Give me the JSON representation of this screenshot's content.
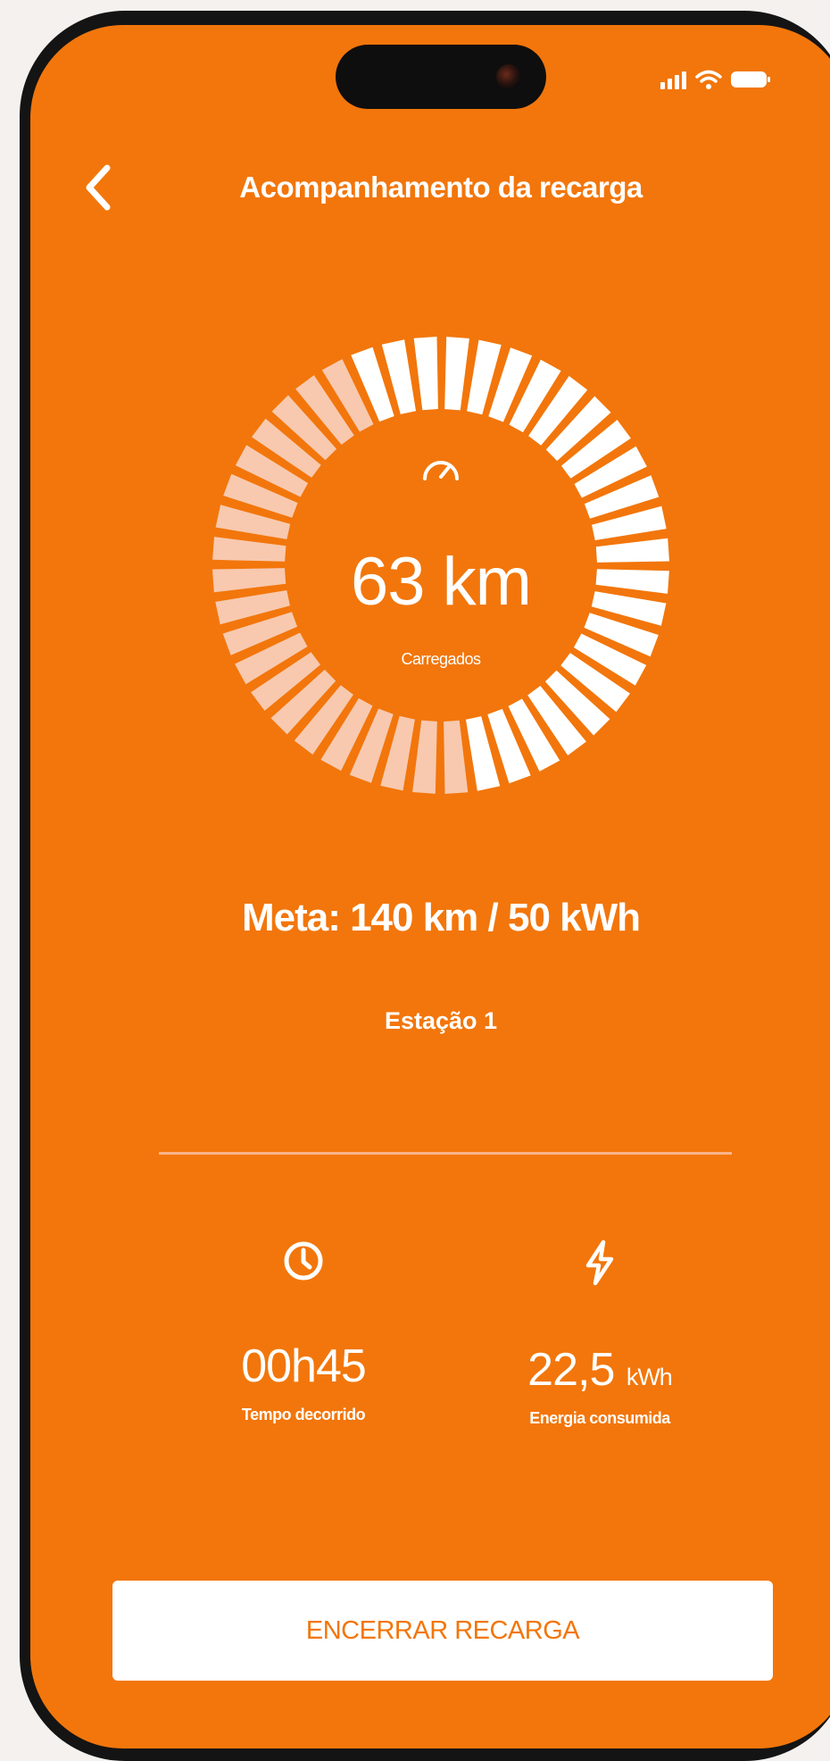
{
  "header": {
    "title": "Acompanhamento da recarga",
    "back_icon": "chevron-left-icon"
  },
  "status_bar": {
    "icons": [
      "cellular-signal-icon",
      "wifi-icon",
      "battery-icon"
    ]
  },
  "charge": {
    "distance_value": "63 km",
    "distance_label": "Carregados",
    "gauge_icon": "speedometer-icon",
    "progress_fraction": 0.45,
    "target": "Meta: 140 km / 50 kWh",
    "station": "Estação 1"
  },
  "stats": {
    "elapsed": {
      "icon": "clock-icon",
      "value": "00h45",
      "label": "Tempo decorrido"
    },
    "energy": {
      "icon": "lightning-icon",
      "value": "22,5",
      "unit": "kWh",
      "label": "Energia consumida"
    }
  },
  "actions": {
    "end_label": "ENCERRAR RECARGA"
  },
  "colors": {
    "background": "#f2760b",
    "filled_segment": "#f8c9af",
    "empty_segment": "#ffffff",
    "button_text": "#f2760b"
  }
}
